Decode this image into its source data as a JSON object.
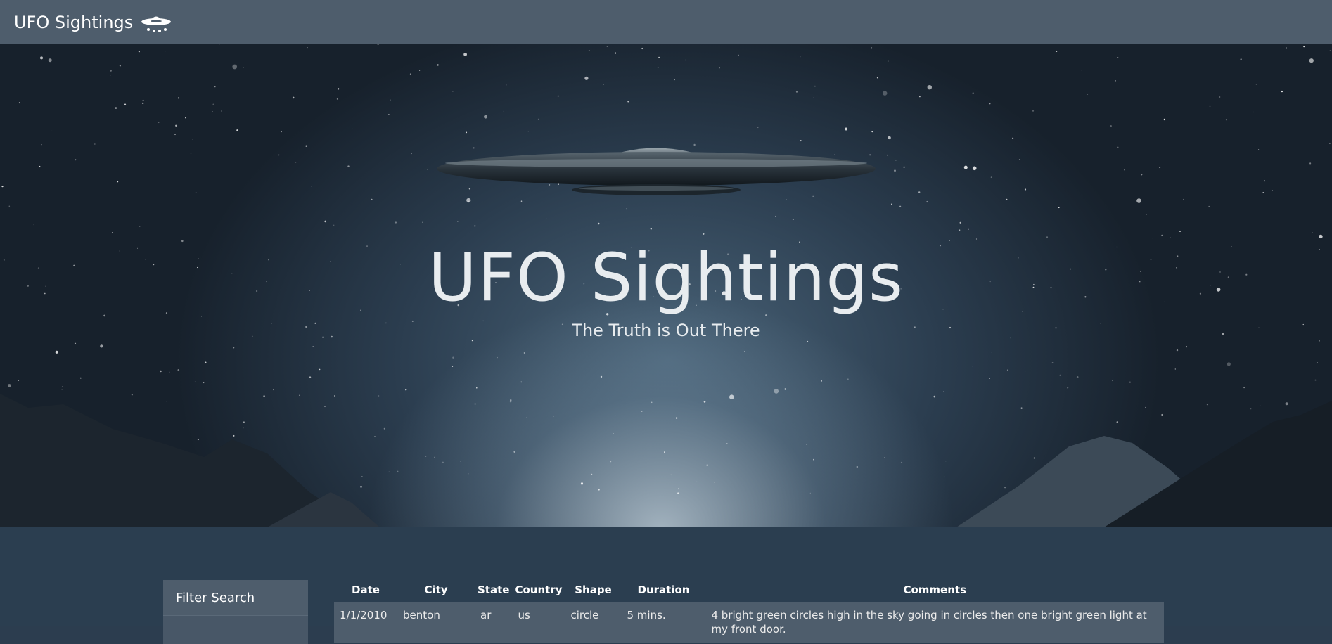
{
  "navbar": {
    "brand_text": "UFO Sightings",
    "brand_icon": "ufo-icon"
  },
  "hero": {
    "title": "UFO Sightings",
    "subtitle": "The Truth is Out There"
  },
  "filter": {
    "heading": "Filter Search"
  },
  "table": {
    "headers": [
      "Date",
      "City",
      "State",
      "Country",
      "Shape",
      "Duration",
      "Comments"
    ],
    "rows": [
      {
        "date": "1/1/2010",
        "city": "benton",
        "state": "ar",
        "country": "us",
        "shape": "circle",
        "duration": "5 mins.",
        "comments": "4 bright green circles high in the sky going in circles then one bright green light at my front door."
      }
    ]
  },
  "colors": {
    "navbar_bg": "#4e5d6c",
    "page_bg": "#2b3e50",
    "text": "#ffffff"
  }
}
